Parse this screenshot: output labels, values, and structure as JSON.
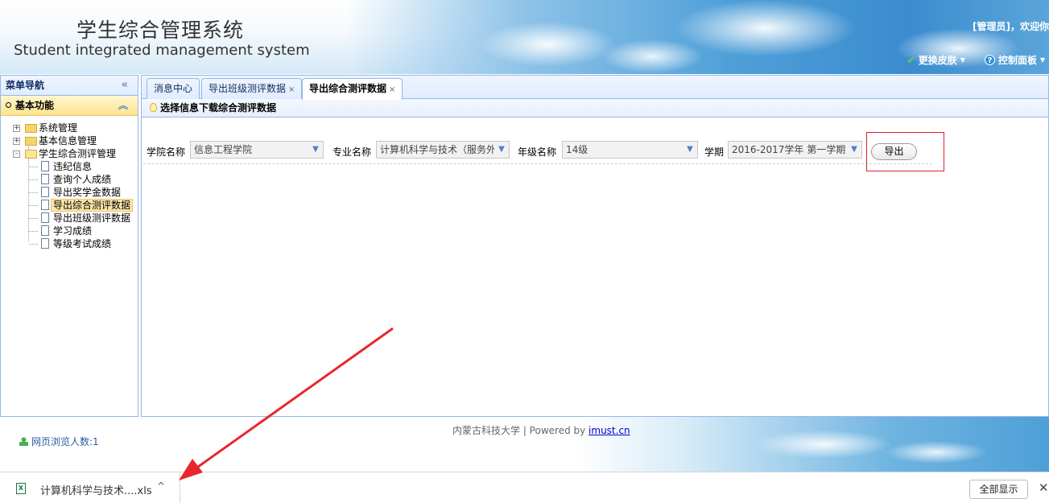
{
  "header": {
    "title_cn": "学生综合管理系统",
    "title_en": "Student integrated management system",
    "welcome": "[管理员]，欢迎你",
    "menu": [
      {
        "label": "更换皮肤",
        "icon": "check-icon"
      },
      {
        "label": "控制面板",
        "icon": "help-icon"
      }
    ]
  },
  "sidebar": {
    "title": "菜单导航",
    "section": "基本功能",
    "tree": [
      {
        "label": "系统管理",
        "icon": "folder-icon",
        "expander": "+"
      },
      {
        "label": "基本信息管理",
        "icon": "folder-icon",
        "expander": "+"
      },
      {
        "label": "学生综合测评管理",
        "icon": "folder-open-icon",
        "expander": "-"
      },
      {
        "label": "违纪信息",
        "icon": "file-icon"
      },
      {
        "label": "查询个人成绩",
        "icon": "file-icon"
      },
      {
        "label": "导出奖学金数据",
        "icon": "file-icon"
      },
      {
        "label": "导出综合测评数据",
        "icon": "file-icon",
        "selected": true
      },
      {
        "label": "导出班级测评数据",
        "icon": "file-icon"
      },
      {
        "label": "学习成绩",
        "icon": "file-icon"
      },
      {
        "label": "等级考试成绩",
        "icon": "file-icon"
      }
    ]
  },
  "tabs": [
    {
      "label": "消息中心",
      "closable": false
    },
    {
      "label": "导出班级测评数据",
      "closable": true
    },
    {
      "label": "导出综合测评数据",
      "closable": true,
      "active": true
    }
  ],
  "tab_close_glyph": "×",
  "info_bar": "选择信息下载综合测评数据",
  "form": {
    "college_label": "学院名称",
    "college_value": "信息工程学院",
    "major_label": "专业名称",
    "major_value": "计算机科学与技术（服务外包",
    "grade_label": "年级名称",
    "grade_value": "14级",
    "term_label": "学期",
    "term_value": "2016-2017学年 第一学期",
    "export_label": "导出"
  },
  "footer": {
    "copyright_prefix": "内蒙古科技大学 | Powered by ",
    "copyright_link": "imust.cn",
    "visitors": "网页浏览人数:1"
  },
  "download_bar": {
    "file_name": "计算机科学与技术....xls",
    "show_all": "全部显示",
    "close": "✕"
  },
  "colors": {
    "border_blue": "#95b8e7",
    "highlight_box": "#e02020",
    "annotation_arrow": "#e8272c"
  }
}
